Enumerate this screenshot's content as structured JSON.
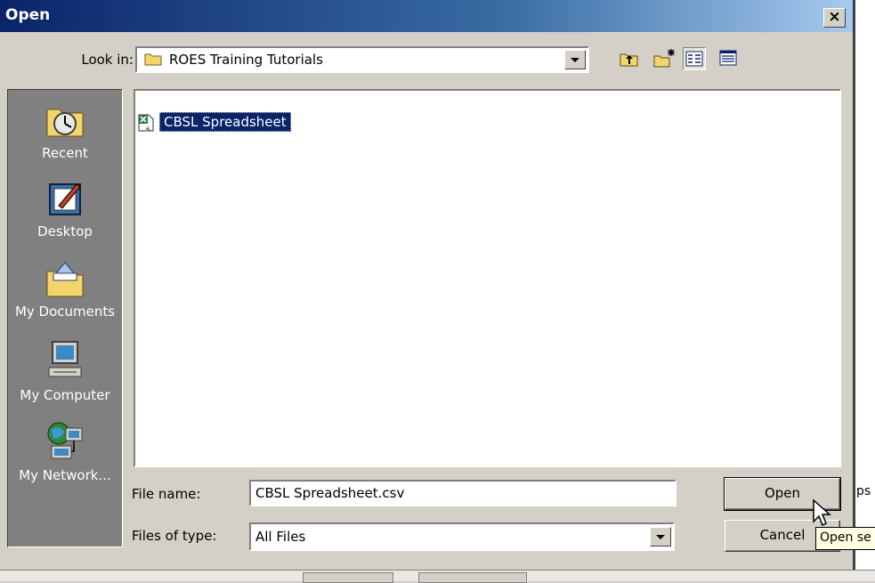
{
  "dialog": {
    "title": "Open",
    "close_symbol": "×"
  },
  "look_in": {
    "label": "Look in:",
    "value": "ROES Training Tutorials"
  },
  "toolbar": {
    "icons": [
      "up-one-level-icon",
      "create-new-folder-icon",
      "list-view-icon",
      "details-view-icon"
    ]
  },
  "places": [
    {
      "label": "Recent",
      "icon": "recent-clock-icon"
    },
    {
      "label": "Desktop",
      "icon": "desktop-icon"
    },
    {
      "label": "My Documents",
      "icon": "my-documents-icon"
    },
    {
      "label": "My Computer",
      "icon": "my-computer-icon"
    },
    {
      "label": "My Network...",
      "icon": "my-network-icon"
    }
  ],
  "files": [
    {
      "name": "CBSL Spreadsheet",
      "icon": "excel-csv-file-icon",
      "selected": true
    }
  ],
  "file_name": {
    "label": "File name:",
    "value": "CBSL Spreadsheet.csv"
  },
  "file_type": {
    "label": "Files of type:",
    "value": "All Files"
  },
  "buttons": {
    "open": "Open",
    "cancel": "Cancel"
  },
  "tooltip": "Open se",
  "background": {
    "edge_text": "ps"
  },
  "colors": {
    "titlebar_start": "#0a246a",
    "titlebar_end": "#a6caf0",
    "dialog_face": "#d4d0c8",
    "places_bar": "#808080",
    "selection": "#0a246a",
    "tooltip_bg": "#ffffe1"
  }
}
